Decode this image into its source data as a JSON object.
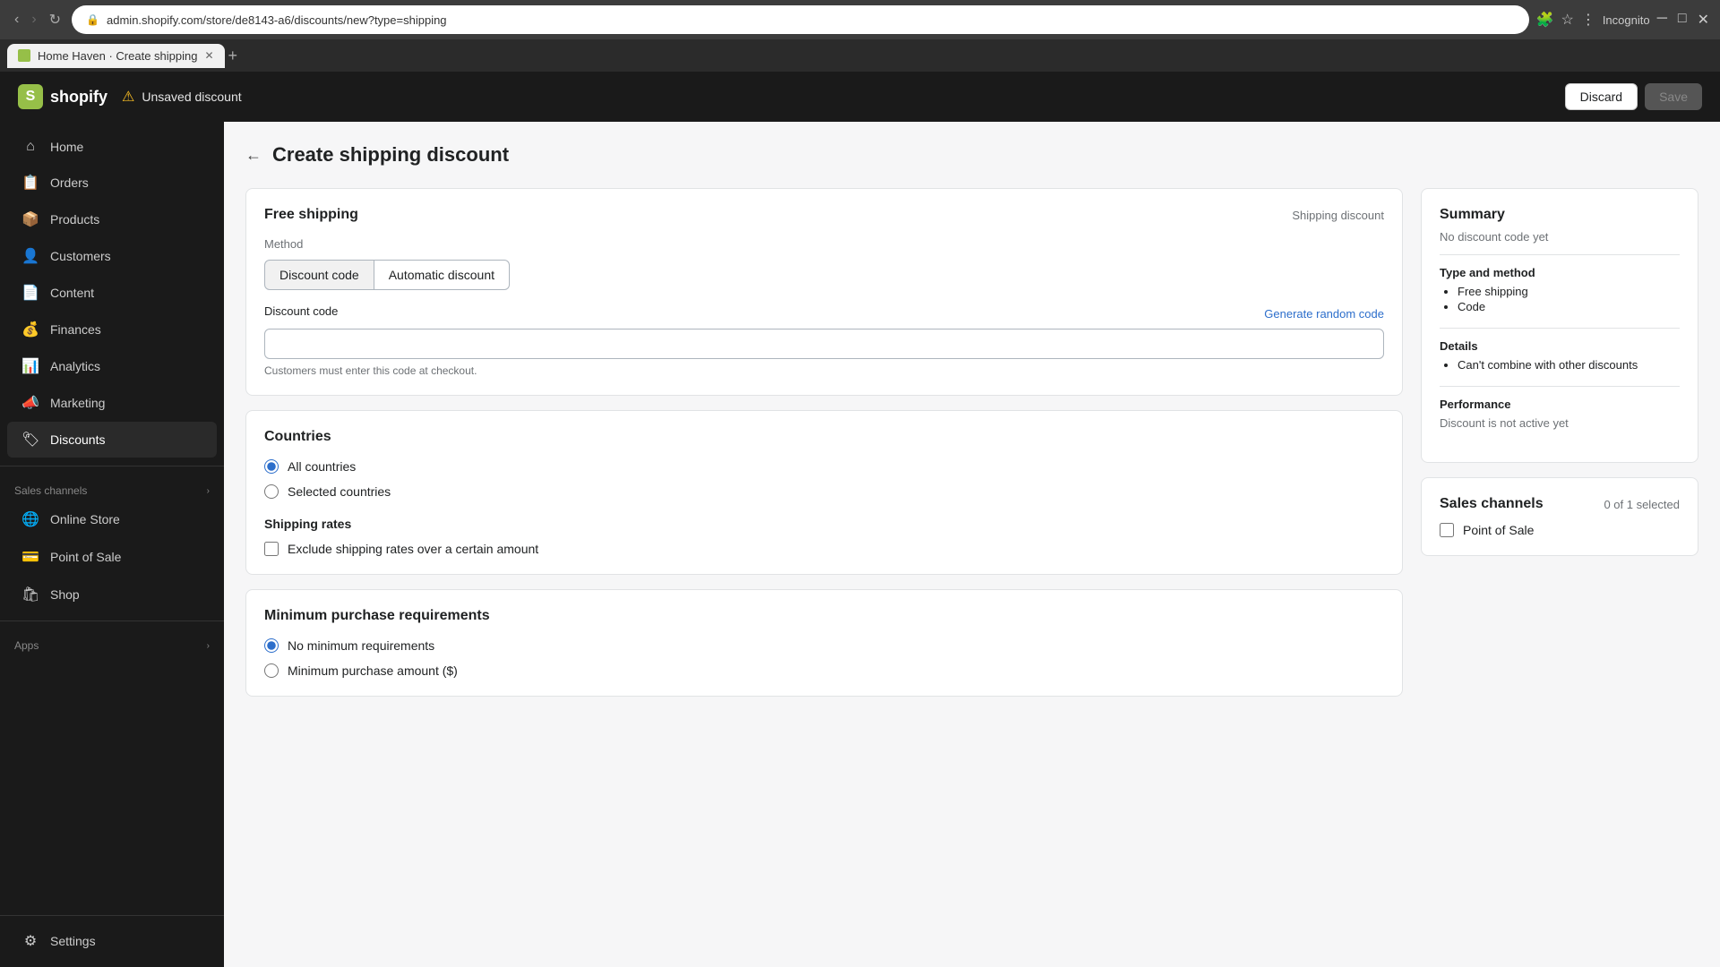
{
  "browser": {
    "tab_title": "Home Haven · Create shipping",
    "url": "admin.shopify.com/store/de8143-a6/discounts/new?type=shipping",
    "new_tab_label": "+",
    "nav_back": "←",
    "nav_forward": "→",
    "refresh": "↻",
    "incognito_label": "Incognito"
  },
  "header": {
    "logo_text": "shopify",
    "logo_letter": "S",
    "unsaved_label": "Unsaved discount",
    "discard_label": "Discard",
    "save_label": "Save"
  },
  "sidebar": {
    "nav_items": [
      {
        "id": "home",
        "label": "Home",
        "icon": "⌂"
      },
      {
        "id": "orders",
        "label": "Orders",
        "icon": "📋"
      },
      {
        "id": "products",
        "label": "Products",
        "icon": "📦"
      },
      {
        "id": "customers",
        "label": "Customers",
        "icon": "👤"
      },
      {
        "id": "content",
        "label": "Content",
        "icon": "📄"
      },
      {
        "id": "finances",
        "label": "Finances",
        "icon": "💰"
      },
      {
        "id": "analytics",
        "label": "Analytics",
        "icon": "📊"
      },
      {
        "id": "marketing",
        "label": "Marketing",
        "icon": "📣"
      },
      {
        "id": "discounts",
        "label": "Discounts",
        "icon": "🏷"
      }
    ],
    "sales_channels_label": "Sales channels",
    "sales_channels": [
      {
        "id": "online-store",
        "label": "Online Store",
        "icon": "🌐"
      },
      {
        "id": "point-of-sale",
        "label": "Point of Sale",
        "icon": "💳"
      },
      {
        "id": "shop",
        "label": "Shop",
        "icon": "🛍"
      }
    ],
    "apps_label": "Apps",
    "settings_label": "Settings",
    "chevron": "›"
  },
  "page": {
    "back_icon": "←",
    "title": "Create shipping discount"
  },
  "form": {
    "card_title": "Free shipping",
    "card_subtitle": "Shipping discount",
    "method_label": "Method",
    "method_options": [
      {
        "id": "discount-code",
        "label": "Discount code",
        "active": true
      },
      {
        "id": "automatic-discount",
        "label": "Automatic discount",
        "active": false
      }
    ],
    "discount_code_label": "Discount code",
    "generate_link": "Generate random code",
    "discount_code_placeholder": "",
    "discount_code_hint": "Customers must enter this code at checkout.",
    "countries_title": "Countries",
    "countries_options": [
      {
        "id": "all-countries",
        "label": "All countries",
        "checked": true
      },
      {
        "id": "selected-countries",
        "label": "Selected countries",
        "checked": false
      }
    ],
    "shipping_rates_title": "Shipping rates",
    "shipping_rates_checkbox": "Exclude shipping rates over a certain amount",
    "shipping_rates_checked": false,
    "minimum_purchase_title": "Minimum purchase requirements",
    "minimum_options": [
      {
        "id": "no-minimum",
        "label": "No minimum requirements",
        "checked": true
      },
      {
        "id": "minimum-amount",
        "label": "Minimum purchase amount ($)",
        "checked": false
      }
    ]
  },
  "summary": {
    "title": "Summary",
    "no_code_yet": "No discount code yet",
    "type_method_title": "Type and method",
    "type_method_items": [
      "Free shipping",
      "Code"
    ],
    "details_title": "Details",
    "details_items": [
      "Can't combine with other discounts"
    ],
    "performance_title": "Performance",
    "performance_text": "Discount is not active yet"
  },
  "sales_channels_card": {
    "title": "Sales channels",
    "count_text": "0 of 1 selected",
    "channels": [
      {
        "id": "point-of-sale",
        "label": "Point of Sale",
        "checked": false
      }
    ]
  }
}
